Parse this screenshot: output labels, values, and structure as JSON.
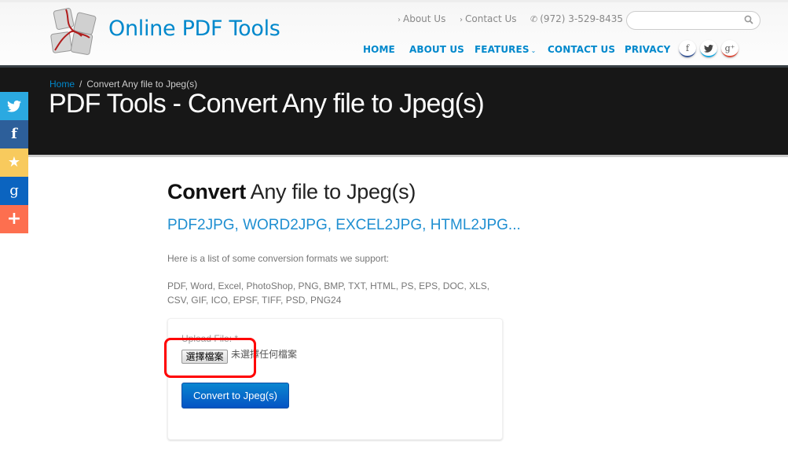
{
  "header": {
    "logo_text": "Online PDF Tools",
    "topbar": {
      "about_link": "About Us",
      "contact_link": "Contact Us",
      "phone": "(972) 3-529-8435",
      "chevron_glyph": "›",
      "phone_glyph": "✆"
    },
    "search": {
      "placeholder": "",
      "value": ""
    },
    "nav": [
      {
        "label": "HOME"
      },
      {
        "label": "ABOUT US"
      },
      {
        "label": "FEATURES"
      },
      {
        "label": "CONTACT US"
      },
      {
        "label": "PRIVACY"
      }
    ],
    "features_caret": "⌄",
    "social": {
      "facebook": "f",
      "twitter": "✦",
      "googleplus": "g⁺"
    }
  },
  "banner": {
    "breadcrumb_home": "Home",
    "breadcrumb_sep": "/",
    "breadcrumb_current": "Convert Any file to Jpeg(s)",
    "title": "PDF Tools - Convert Any file to Jpeg(s)"
  },
  "share_bar": {
    "twitter": "🐦",
    "facebook": "f",
    "favorite": "★",
    "google": "g",
    "more": "+"
  },
  "main": {
    "heading_bold": "Convert",
    "heading_light": " Any file to Jpeg(s)",
    "subheading": "PDF2JPG, WORD2JPG, EXCEL2JPG, HTML2JPG...",
    "intro": "Here is a list of some conversion formats we support:",
    "formats": "PDF, Word, Excel, PhotoShop, PNG, BMP, TXT, HTML, PS, EPS, DOC, XLS, CSV, GIF, ICO, EPSF, TIFF, PSD, PNG24",
    "form": {
      "upload_label": "Upload File: *",
      "choose_file_button": "選擇檔案",
      "file_status": "未選擇任何檔案",
      "submit_button": "Convert to Jpeg(s)"
    }
  },
  "colors": {
    "brand_blue": "#0088cc",
    "banner_bg": "#171717",
    "highlight_red": "#ff0000",
    "button_blue": "#0a6fd0"
  }
}
